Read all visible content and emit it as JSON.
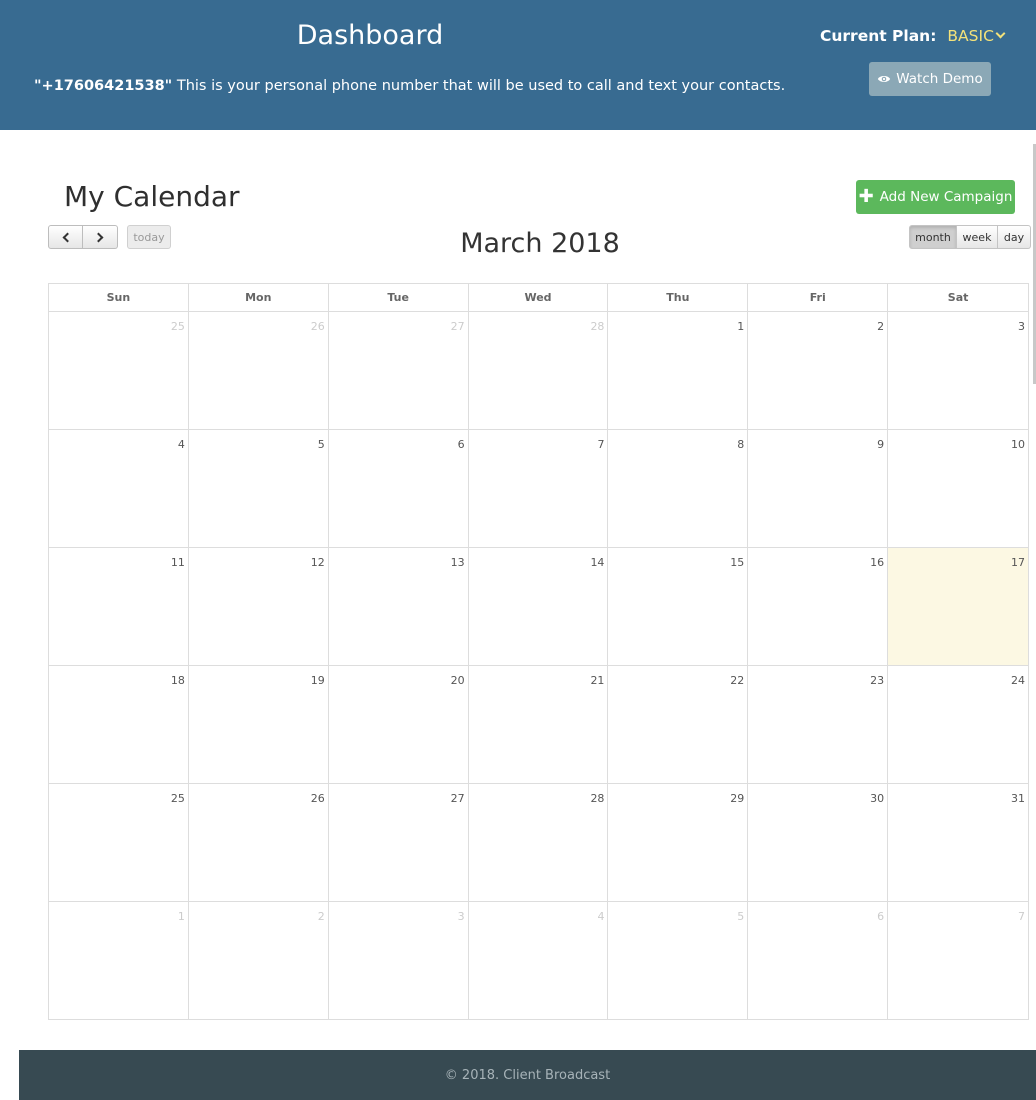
{
  "header": {
    "title": "Dashboard",
    "phone_number": "\"+17606421538\"",
    "phone_text": " This is your personal phone number that will be used to call and text your contacts.",
    "plan_label": "Current Plan:",
    "plan_value": "BASIC",
    "watch_demo_label": "Watch Demo"
  },
  "calendar": {
    "heading": "My Calendar",
    "add_campaign_label": "Add New Campaign",
    "today_label": "today",
    "month_title": "March 2018",
    "views": [
      "month",
      "week",
      "day"
    ],
    "active_view": "month",
    "weekdays": [
      "Sun",
      "Mon",
      "Tue",
      "Wed",
      "Thu",
      "Fri",
      "Sat"
    ],
    "weeks": [
      [
        {
          "d": "25",
          "o": true
        },
        {
          "d": "26",
          "o": true
        },
        {
          "d": "27",
          "o": true
        },
        {
          "d": "28",
          "o": true
        },
        {
          "d": "1"
        },
        {
          "d": "2"
        },
        {
          "d": "3"
        }
      ],
      [
        {
          "d": "4"
        },
        {
          "d": "5"
        },
        {
          "d": "6"
        },
        {
          "d": "7"
        },
        {
          "d": "8"
        },
        {
          "d": "9"
        },
        {
          "d": "10"
        }
      ],
      [
        {
          "d": "11"
        },
        {
          "d": "12"
        },
        {
          "d": "13"
        },
        {
          "d": "14"
        },
        {
          "d": "15"
        },
        {
          "d": "16"
        },
        {
          "d": "17",
          "t": true
        }
      ],
      [
        {
          "d": "18"
        },
        {
          "d": "19"
        },
        {
          "d": "20"
        },
        {
          "d": "21"
        },
        {
          "d": "22"
        },
        {
          "d": "23"
        },
        {
          "d": "24"
        }
      ],
      [
        {
          "d": "25"
        },
        {
          "d": "26"
        },
        {
          "d": "27"
        },
        {
          "d": "28"
        },
        {
          "d": "29"
        },
        {
          "d": "30"
        },
        {
          "d": "31"
        }
      ],
      [
        {
          "d": "1",
          "o": true
        },
        {
          "d": "2",
          "o": true
        },
        {
          "d": "3",
          "o": true
        },
        {
          "d": "4",
          "o": true
        },
        {
          "d": "5",
          "o": true
        },
        {
          "d": "6",
          "o": true
        },
        {
          "d": "7",
          "o": true
        }
      ]
    ]
  },
  "footer": {
    "copyright": "© 2018. Client Broadcast"
  },
  "colors": {
    "header_bg": "#386b91",
    "plan_accent": "#f3e27a",
    "add_button": "#5cb85c",
    "today_highlight": "#fcf8e3",
    "footer_bg": "#374a52"
  },
  "icons": {
    "watch_demo": "eye-icon",
    "add_campaign": "plus-icon",
    "plan_dropdown": "chevron-down-icon",
    "prev": "chevron-left-icon",
    "next": "chevron-right-icon"
  }
}
